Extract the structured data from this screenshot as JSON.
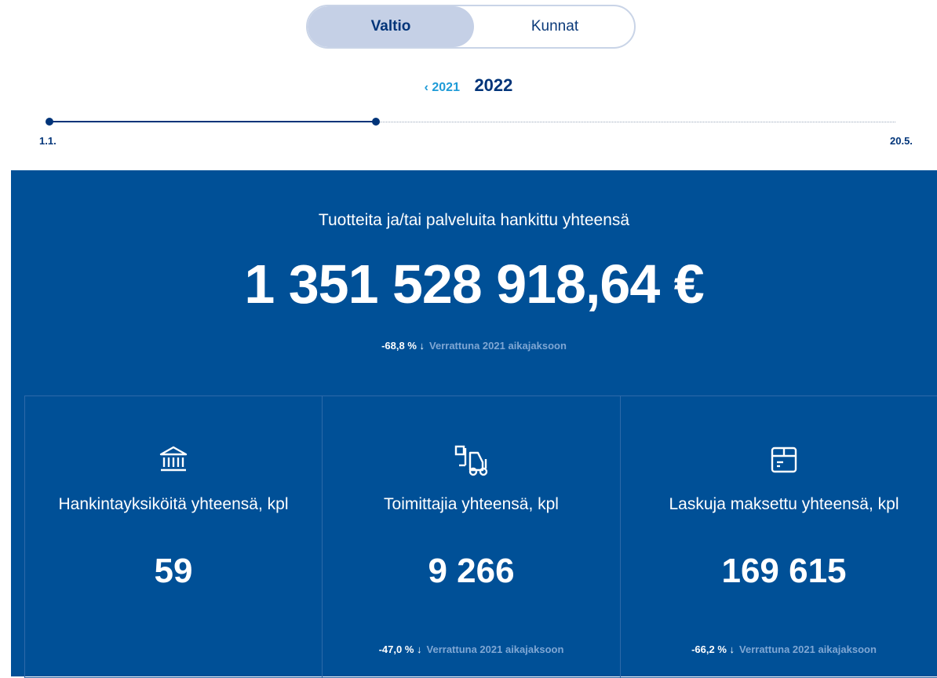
{
  "toggle": {
    "active": "Valtio",
    "inactive": "Kunnat"
  },
  "years": {
    "prev": "‹ 2021",
    "current": "2022"
  },
  "timeline": {
    "start_label": "1.1.",
    "end_label": "20.5.",
    "progress": 0.386
  },
  "summary": {
    "title": "Tuotteita ja/tai palveluita hankittu yhteensä",
    "value": "1 351 528 918,64 €",
    "change": "-68,8 % ↓",
    "change_note": "Verrattuna 2021 aikajaksoon"
  },
  "cards": [
    {
      "icon": "bank-icon",
      "label": "Hankintayksiköitä yhteensä, kpl",
      "value": "59",
      "change": "",
      "change_note": ""
    },
    {
      "icon": "forklift-icon",
      "label": "Toimittajia yhteensä, kpl",
      "value": "9 266",
      "change": "-47,0 % ↓",
      "change_note": "Verrattuna 2021 aikajaksoon"
    },
    {
      "icon": "invoice-box-icon",
      "label": "Laskuja maksettu yhteensä, kpl",
      "value": "169 615",
      "change": "-66,2 % ↓",
      "change_note": "Verrattuna 2021 aikajaksoon"
    }
  ],
  "colors": {
    "panel": "#005097",
    "dark_blue": "#003479",
    "accent": "#1e9bd7"
  }
}
